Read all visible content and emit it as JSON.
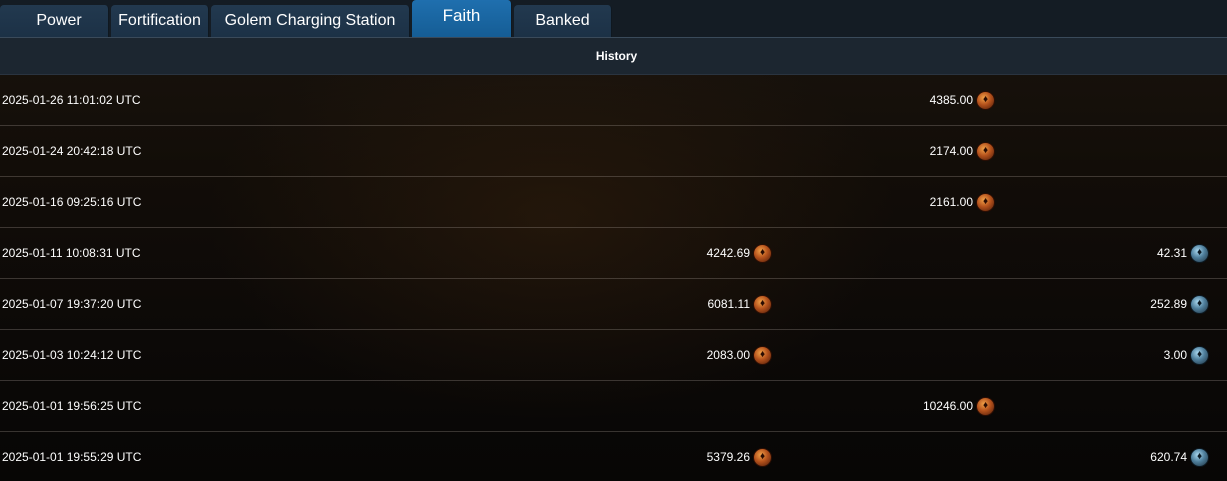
{
  "tabs": [
    {
      "label": "Power"
    },
    {
      "label": "Fortification"
    },
    {
      "label": "Golem Charging Station"
    },
    {
      "label": "Faith"
    },
    {
      "label": "Banked"
    }
  ],
  "active_tab": "Faith",
  "history": {
    "title": "History",
    "rows": [
      {
        "date": "2025-01-26 11:01:02 UTC",
        "mid": "",
        "center": "4385.00",
        "right": ""
      },
      {
        "date": "2025-01-24 20:42:18 UTC",
        "mid": "",
        "center": "2174.00",
        "right": ""
      },
      {
        "date": "2025-01-16 09:25:16 UTC",
        "mid": "",
        "center": "2161.00",
        "right": ""
      },
      {
        "date": "2025-01-11 10:08:31 UTC",
        "mid": "4242.69",
        "center": "",
        "right": "42.31"
      },
      {
        "date": "2025-01-07 19:37:20 UTC",
        "mid": "6081.11",
        "center": "",
        "right": "252.89"
      },
      {
        "date": "2025-01-03 10:24:12 UTC",
        "mid": "2083.00",
        "center": "",
        "right": "3.00"
      },
      {
        "date": "2025-01-01 19:56:25 UTC",
        "mid": "",
        "center": "10246.00",
        "right": ""
      },
      {
        "date": "2025-01-01 19:55:29 UTC",
        "mid": "5379.26",
        "center": "",
        "right": "620.74"
      }
    ]
  },
  "icons": {
    "faith_coin": "faith-coin-icon",
    "blue_coin": "blue-coin-icon"
  },
  "colors": {
    "active_tab": "#1f6fae",
    "tab": "#1c3146",
    "header_bar": "#1c2630"
  }
}
